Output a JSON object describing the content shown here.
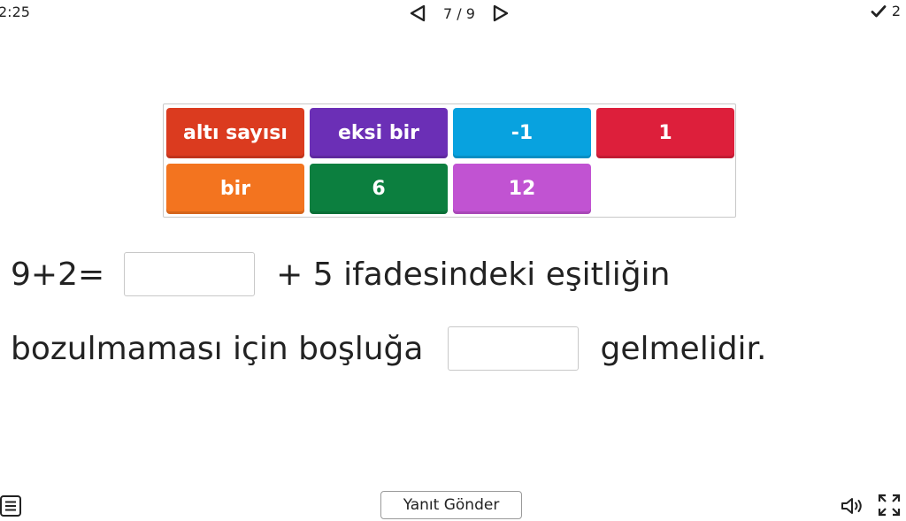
{
  "header": {
    "timer": "2:25",
    "page_counter": "7 / 9",
    "score": "2",
    "prev_icon": "triangle-left-icon",
    "next_icon": "triangle-right-icon",
    "score_icon": "check-icon"
  },
  "tiles": [
    {
      "label": "altı sayısı",
      "color": "#db3b1f"
    },
    {
      "label": "eksi bir",
      "color": "#6b2fb6"
    },
    {
      "label": "-1",
      "color": "#08a2df"
    },
    {
      "label": "1",
      "color": "#dd1f3b"
    },
    {
      "label": "bir",
      "color": "#f3741f"
    },
    {
      "label": "6",
      "color": "#0c7f3f"
    },
    {
      "label": "12",
      "color": "#c153d2"
    }
  ],
  "question": {
    "line1": {
      "before": "9+2=",
      "after": "+ 5 ifadesindeki  eşitliğin"
    },
    "line2": {
      "before": "bozulmaması  için  boşluğa",
      "after": "gelmelidir."
    }
  },
  "footer": {
    "submit_label": "Yanıt Gönder",
    "menu_icon": "menu-icon",
    "sound_icon": "speaker-icon",
    "fullscreen_icon": "fullscreen-icon"
  }
}
